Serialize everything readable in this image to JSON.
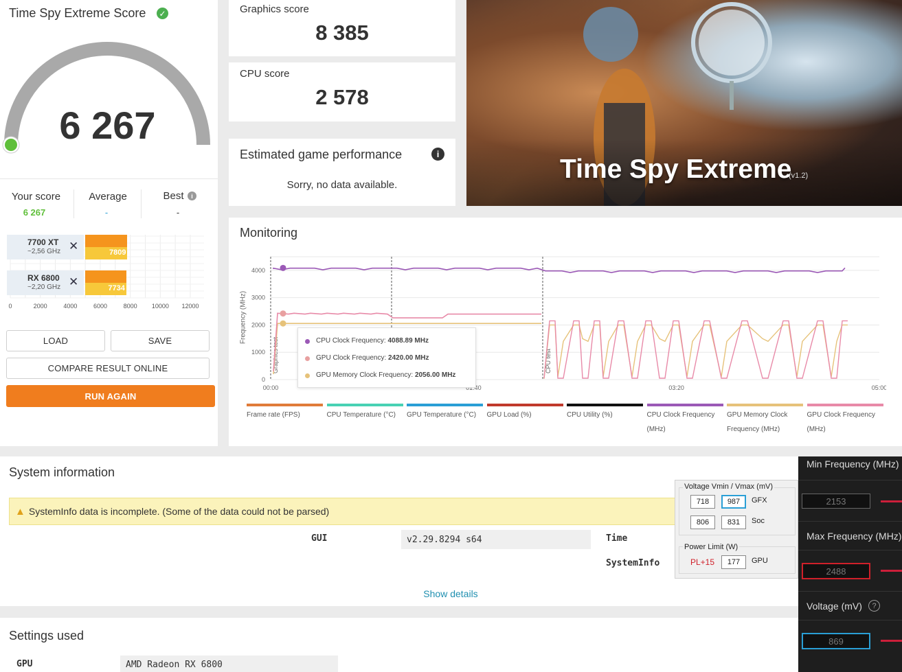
{
  "score_card": {
    "title": "Time Spy Extreme Score",
    "score": "6 267",
    "your_score_label": "Your score",
    "your_score_value": "6 267",
    "average_label": "Average",
    "average_value": "-",
    "best_label": "Best",
    "best_value": "-",
    "gauge_fraction": 0.0
  },
  "comparison": {
    "rows": [
      {
        "gpu": "7700 XT",
        "clock": "~2,56 GHz",
        "value": 7809,
        "value_label": "7809"
      },
      {
        "gpu": "RX 6800",
        "clock": "~2,20 GHz",
        "value": 7734,
        "value_label": "7734"
      }
    ],
    "axis_ticks": [
      "0",
      "2000",
      "4000",
      "6000",
      "8000",
      "10000",
      "12000"
    ],
    "axis_max": 12000
  },
  "actions": {
    "load": "LOAD",
    "save": "SAVE",
    "compare": "COMPARE RESULT ONLINE",
    "run_again": "RUN AGAIN"
  },
  "graphics_score": {
    "label": "Graphics score",
    "value": "8 385"
  },
  "cpu_score": {
    "label": "CPU score",
    "value": "2 578"
  },
  "game_perf": {
    "title": "Estimated game performance",
    "message": "Sorry, no data available."
  },
  "hero": {
    "title": "Time Spy Extreme",
    "version": "(v1.2)"
  },
  "monitoring": {
    "title": "Monitoring",
    "y_axis_label": "Frequency (MHz)",
    "y_ticks": [
      "4000",
      "3000",
      "2000",
      "1000",
      "0"
    ],
    "x_ticks": [
      "00:00",
      "01:40",
      "03:20",
      "05:00"
    ],
    "phase_labels": [
      "Graphics test",
      "CPU test"
    ],
    "tooltip": [
      {
        "label": "CPU Clock Frequency:",
        "value": "4088.89 MHz",
        "color": "#9b59b6"
      },
      {
        "label": "GPU Clock Frequency:",
        "value": "2420.00 MHz",
        "color": "#e8a0a0"
      },
      {
        "label": "GPU Memory Clock Frequency:",
        "value": "2056.00 MHz",
        "color": "#e6c27a"
      }
    ],
    "legend": [
      {
        "label": "Frame rate (FPS)",
        "color": "#e07b39"
      },
      {
        "label": "CPU Temperature (°C)",
        "color": "#48d1b4"
      },
      {
        "label": "GPU Temperature (°C)",
        "color": "#2a9fd6"
      },
      {
        "label": "GPU Load (%)",
        "color": "#c0392b"
      },
      {
        "label": "CPU Utility (%)",
        "color": "#111111"
      },
      {
        "label": "CPU Clock Frequency (MHz)",
        "color": "#9b59b6"
      },
      {
        "label": "GPU Memory Clock Frequency (MHz)",
        "color": "#e6c27a"
      },
      {
        "label": "GPU Clock Frequency (MHz)",
        "color": "#e88aa8"
      }
    ]
  },
  "system_info": {
    "title": "System information",
    "warning": "SystemInfo data is incomplete. (Some of the data could not be parsed)",
    "gui_label": "GUI",
    "gui_value": "v2.29.8294 s64",
    "time_label": "Time",
    "systeminfo_label": "SystemInfo",
    "show_details": "Show details"
  },
  "settings": {
    "title": "Settings used",
    "gpu_label": "GPU",
    "gpu_value": "AMD Radeon RX 6800"
  },
  "voltage_panel": {
    "title": "Voltage Vmin / Vmax (mV)",
    "gfx_min": "718",
    "gfx_max": "987",
    "gfx_label": "GFX",
    "soc_min": "806",
    "soc_max": "831",
    "soc_label": "Soc",
    "power_title": "Power Limit (W)",
    "power_offset": "PL+15",
    "power_value": "177",
    "power_label": "GPU"
  },
  "amd_panel": {
    "min_freq_label": "Min Frequency (MHz)",
    "min_freq_value": "2153",
    "max_freq_label": "Max Frequency (MHz)",
    "max_freq_value": "2488",
    "voltage_label": "Voltage (mV)",
    "voltage_value": "869"
  }
}
